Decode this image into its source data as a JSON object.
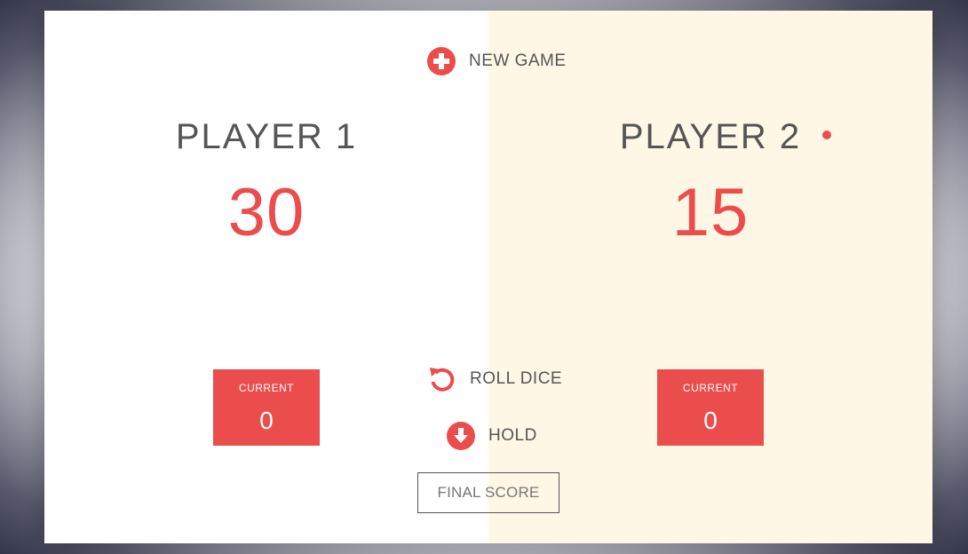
{
  "players": [
    {
      "name": "PLAYER 1",
      "score": "30",
      "current_label": "CURRENT",
      "current_score": "0",
      "active": false
    },
    {
      "name": "PLAYER 2",
      "score": "15",
      "current_label": "CURRENT",
      "current_score": "0",
      "active": true
    }
  ],
  "controls": {
    "new_game_label": "NEW GAME",
    "new_game_icon": "plus-circle-icon",
    "roll_dice_label": "ROLL DICE",
    "roll_dice_icon": "rotate-ccw-icon",
    "hold_label": "HOLD",
    "hold_icon": "arrow-down-circle-icon"
  },
  "final_score": {
    "placeholder": "FINAL SCORE",
    "value": ""
  },
  "colors": {
    "accent": "#eb4d4d",
    "active_panel_bg": "#fff7e6",
    "panel_bg": "#ffffff",
    "text": "#555555"
  }
}
